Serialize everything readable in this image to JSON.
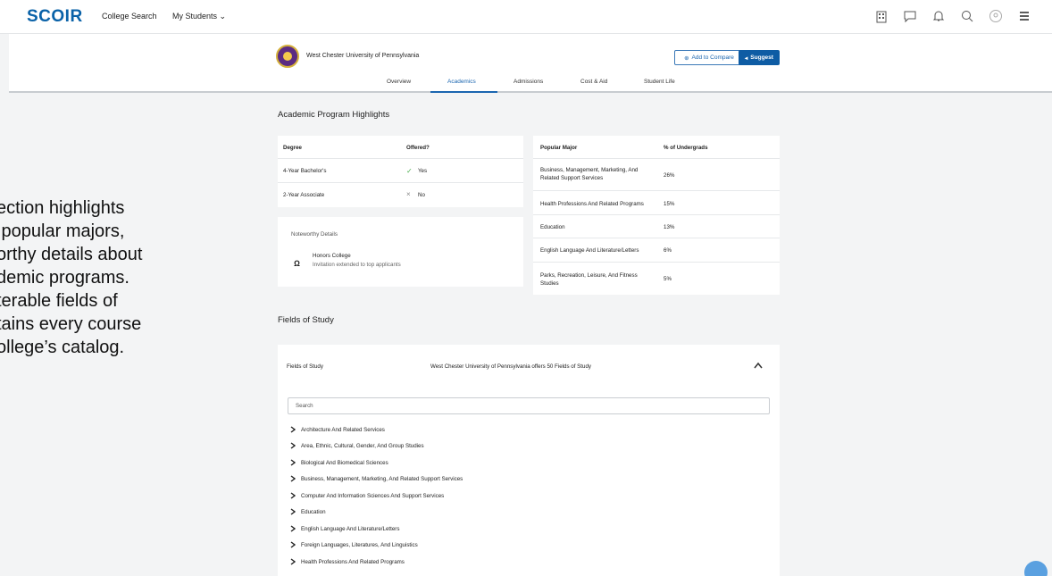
{
  "nav": {
    "logo": "SCOIR",
    "college_search": "College Search",
    "my_students": "My Students"
  },
  "college": {
    "name": "West Chester University of Pennsylvania",
    "add_compare": "Add to Compare",
    "suggest": "Suggest"
  },
  "tabs": [
    "Overview",
    "Academics",
    "Admissions",
    "Cost & Aid",
    "Student Life"
  ],
  "highlights": {
    "title": "Academic Program Highlights",
    "degree_header": "Degree",
    "offered_header": "Offered?",
    "degrees": [
      {
        "name": "4-Year Bachelor's",
        "mark": "✓",
        "offered": "Yes"
      },
      {
        "name": "2-Year Associate",
        "mark": "×",
        "offered": "No"
      }
    ],
    "noteworthy_title": "Noteworthy Details",
    "noteworthy_item": "Honors College",
    "noteworthy_sub": "Invitation extended to top applicants",
    "major_header": "Popular Major",
    "pct_header": "% of Undergrads",
    "majors": [
      {
        "name": "Business, Management, Marketing, And Related Support Services",
        "pct": "26%"
      },
      {
        "name": "Health Professions And Related Programs",
        "pct": "15%"
      },
      {
        "name": "Education",
        "pct": "13%"
      },
      {
        "name": "English Language And Literature/Letters",
        "pct": "6%"
      },
      {
        "name": "Parks, Recreation, Leisure, And Fitness Studies",
        "pct": "5%"
      }
    ]
  },
  "fields": {
    "title": "Fields of Study",
    "header_label": "Fields of Study",
    "summary": "West Chester University of Pennsylvania offers 50 Fields of Study",
    "search_placeholder": "Search",
    "items": [
      "Architecture And Related Services",
      "Area, Ethnic, Cultural, Gender, And Group Studies",
      "Biological And Biomedical Sciences",
      "Business, Management, Marketing, And Related Support Services",
      "Computer And Information Sciences And Support Services",
      "Education",
      "English Language And Literature/Letters",
      "Foreign Languages, Literatures, And Linguistics",
      "Health Professions And Related Programs"
    ]
  },
  "overlay": "ection highlights\n popular majors,\northy details about\ndemic programs.\nterable fields of\ntains every course\nollege’s catalog."
}
